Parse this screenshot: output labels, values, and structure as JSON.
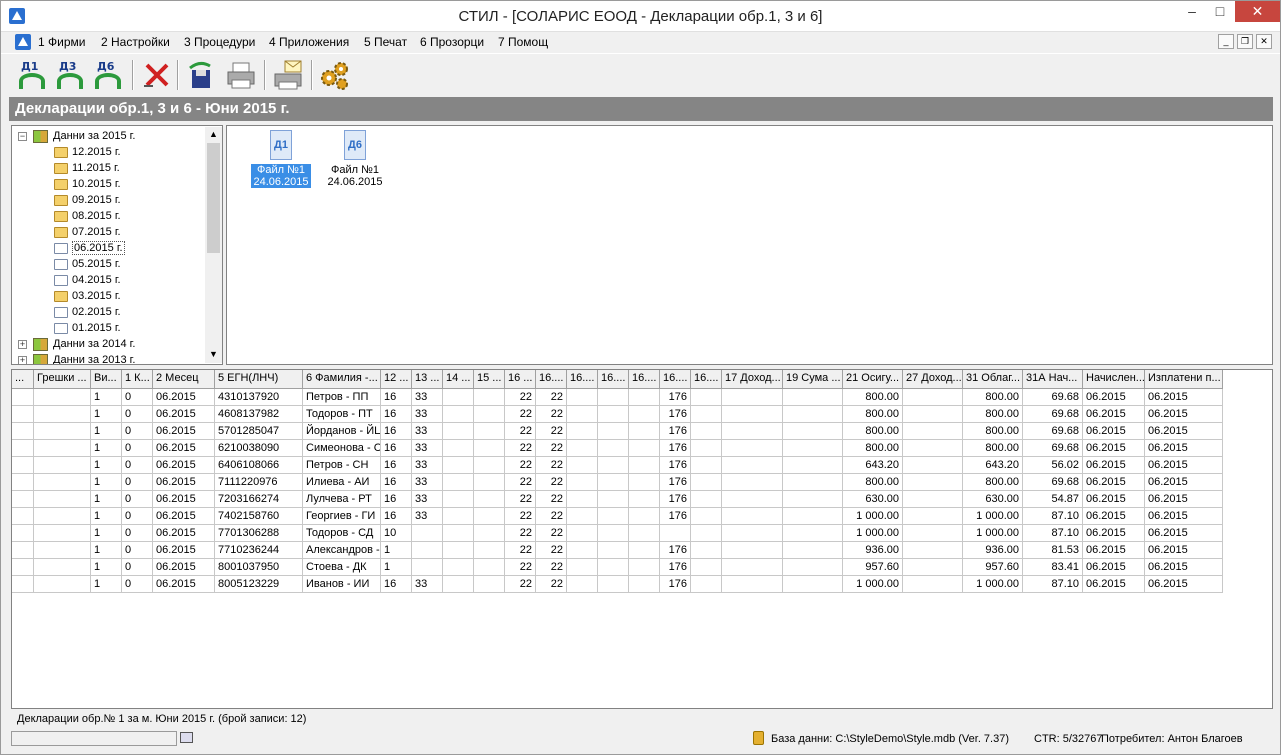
{
  "window": {
    "title": "СТИЛ - [СОЛАРИС ЕООД - Декларации обр.1, 3 и 6]"
  },
  "menu": [
    "1 Фирми",
    "2 Настройки",
    "3 Процедури",
    "4 Приложения",
    "5 Печат",
    "6 Прозорци",
    "7 Помощ"
  ],
  "toolbar": {
    "d1": "Д1",
    "d3": "Д3",
    "d6": "Д6"
  },
  "heading": "Декларации обр.1, 3 и 6 - Юни 2015 г.",
  "tree": {
    "root": "Данни за 2015 г.",
    "months": [
      "12.2015 г.",
      "11.2015 г.",
      "10.2015 г.",
      "09.2015 г.",
      "08.2015 г.",
      "07.2015 г.",
      "06.2015 г.",
      "05.2015 г.",
      "04.2015 г.",
      "03.2015 г.",
      "02.2015 г.",
      "01.2015 г."
    ],
    "others": [
      "Данни за 2014 г.",
      "Данни за 2013 г."
    ]
  },
  "files": [
    {
      "icon_text": "Д1",
      "line1": "Файл №1",
      "line2": "24.06.2015",
      "selected": true
    },
    {
      "icon_text": "Д6",
      "line1": "Файл №1",
      "line2": "24.06.2015",
      "selected": false
    }
  ],
  "grid": {
    "headers": [
      "...",
      "Грешки ...",
      "Ви...",
      "1 К...",
      "2 Месец",
      "5 ЕГН(ЛНЧ)",
      "6 Фамилия -...",
      "12 ...",
      "13 ...",
      "14 ...",
      "15 ...",
      "16 ...",
      "16....",
      "16....",
      "16....",
      "16....",
      "16....",
      "16....",
      "17 Доход...",
      "19 Сума ...",
      "21 Осигу...",
      "27 Доход...",
      "31 Облаг...",
      "31А Нач...",
      "Начислен...",
      "Изплатени п..."
    ],
    "rows": [
      [
        "",
        "",
        "1",
        "0",
        "06.2015",
        "4310137920",
        "Петров - ПП",
        "16",
        "33",
        "",
        "",
        "22",
        "22",
        "",
        "",
        "",
        "176",
        "",
        "",
        "",
        "800.00",
        "",
        "800.00",
        "69.68",
        "06.2015",
        "06.2015"
      ],
      [
        "",
        "",
        "1",
        "0",
        "06.2015",
        "4608137982",
        "Тодоров - ПТ",
        "16",
        "33",
        "",
        "",
        "22",
        "22",
        "",
        "",
        "",
        "176",
        "",
        "",
        "",
        "800.00",
        "",
        "800.00",
        "69.68",
        "06.2015",
        "06.2015"
      ],
      [
        "",
        "",
        "1",
        "0",
        "06.2015",
        "5701285047",
        "Йорданов - ЙЦ",
        "16",
        "33",
        "",
        "",
        "22",
        "22",
        "",
        "",
        "",
        "176",
        "",
        "",
        "",
        "800.00",
        "",
        "800.00",
        "69.68",
        "06.2015",
        "06.2015"
      ],
      [
        "",
        "",
        "1",
        "0",
        "06.2015",
        "6210038090",
        "Симеонова - С",
        "16",
        "33",
        "",
        "",
        "22",
        "22",
        "",
        "",
        "",
        "176",
        "",
        "",
        "",
        "800.00",
        "",
        "800.00",
        "69.68",
        "06.2015",
        "06.2015"
      ],
      [
        "",
        "",
        "1",
        "0",
        "06.2015",
        "6406108066",
        "Петров - СН",
        "16",
        "33",
        "",
        "",
        "22",
        "22",
        "",
        "",
        "",
        "176",
        "",
        "",
        "",
        "643.20",
        "",
        "643.20",
        "56.02",
        "06.2015",
        "06.2015"
      ],
      [
        "",
        "",
        "1",
        "0",
        "06.2015",
        "7111220976",
        "Илиева - АИ",
        "16",
        "33",
        "",
        "",
        "22",
        "22",
        "",
        "",
        "",
        "176",
        "",
        "",
        "",
        "800.00",
        "",
        "800.00",
        "69.68",
        "06.2015",
        "06.2015"
      ],
      [
        "",
        "",
        "1",
        "0",
        "06.2015",
        "7203166274",
        "Лулчева - РТ",
        "16",
        "33",
        "",
        "",
        "22",
        "22",
        "",
        "",
        "",
        "176",
        "",
        "",
        "",
        "630.00",
        "",
        "630.00",
        "54.87",
        "06.2015",
        "06.2015"
      ],
      [
        "",
        "",
        "1",
        "0",
        "06.2015",
        "7402158760",
        "Георгиев - ГИ",
        "16",
        "33",
        "",
        "",
        "22",
        "22",
        "",
        "",
        "",
        "176",
        "",
        "",
        "",
        "1 000.00",
        "",
        "1 000.00",
        "87.10",
        "06.2015",
        "06.2015"
      ],
      [
        "",
        "",
        "1",
        "0",
        "06.2015",
        "7701306288",
        "Тодоров - СД",
        "10",
        "",
        "",
        "",
        "22",
        "22",
        "",
        "",
        "",
        "",
        "",
        "",
        "",
        "1 000.00",
        "",
        "1 000.00",
        "87.10",
        "06.2015",
        "06.2015"
      ],
      [
        "",
        "",
        "1",
        "0",
        "06.2015",
        "7710236244",
        "Александров -",
        "1",
        "",
        "",
        "",
        "22",
        "22",
        "",
        "",
        "",
        "176",
        "",
        "",
        "",
        "936.00",
        "",
        "936.00",
        "81.53",
        "06.2015",
        "06.2015"
      ],
      [
        "",
        "",
        "1",
        "0",
        "06.2015",
        "8001037950",
        "Стоева - ДК",
        "1",
        "",
        "",
        "",
        "22",
        "22",
        "",
        "",
        "",
        "176",
        "",
        "",
        "",
        "957.60",
        "",
        "957.60",
        "83.41",
        "06.2015",
        "06.2015"
      ],
      [
        "",
        "",
        "1",
        "0",
        "06.2015",
        "8005123229",
        "Иванов - ИИ",
        "16",
        "33",
        "",
        "",
        "22",
        "22",
        "",
        "",
        "",
        "176",
        "",
        "",
        "",
        "1 000.00",
        "",
        "1 000.00",
        "87.10",
        "06.2015",
        "06.2015"
      ]
    ]
  },
  "status_line": "Декларации обр.№ 1 за м. Юни 2015 г. (брой записи: 12)",
  "statusbar": {
    "db": "База данни: C:\\StyleDemo\\Style.mdb (Ver. 7.37)",
    "ctr": "CTR: 5/32767",
    "user": "Потребител: Антон Благоев"
  },
  "colors": {
    "heading_bg": "#858585",
    "close_btn": "#c7463e",
    "selection": "#3a8ee6"
  }
}
